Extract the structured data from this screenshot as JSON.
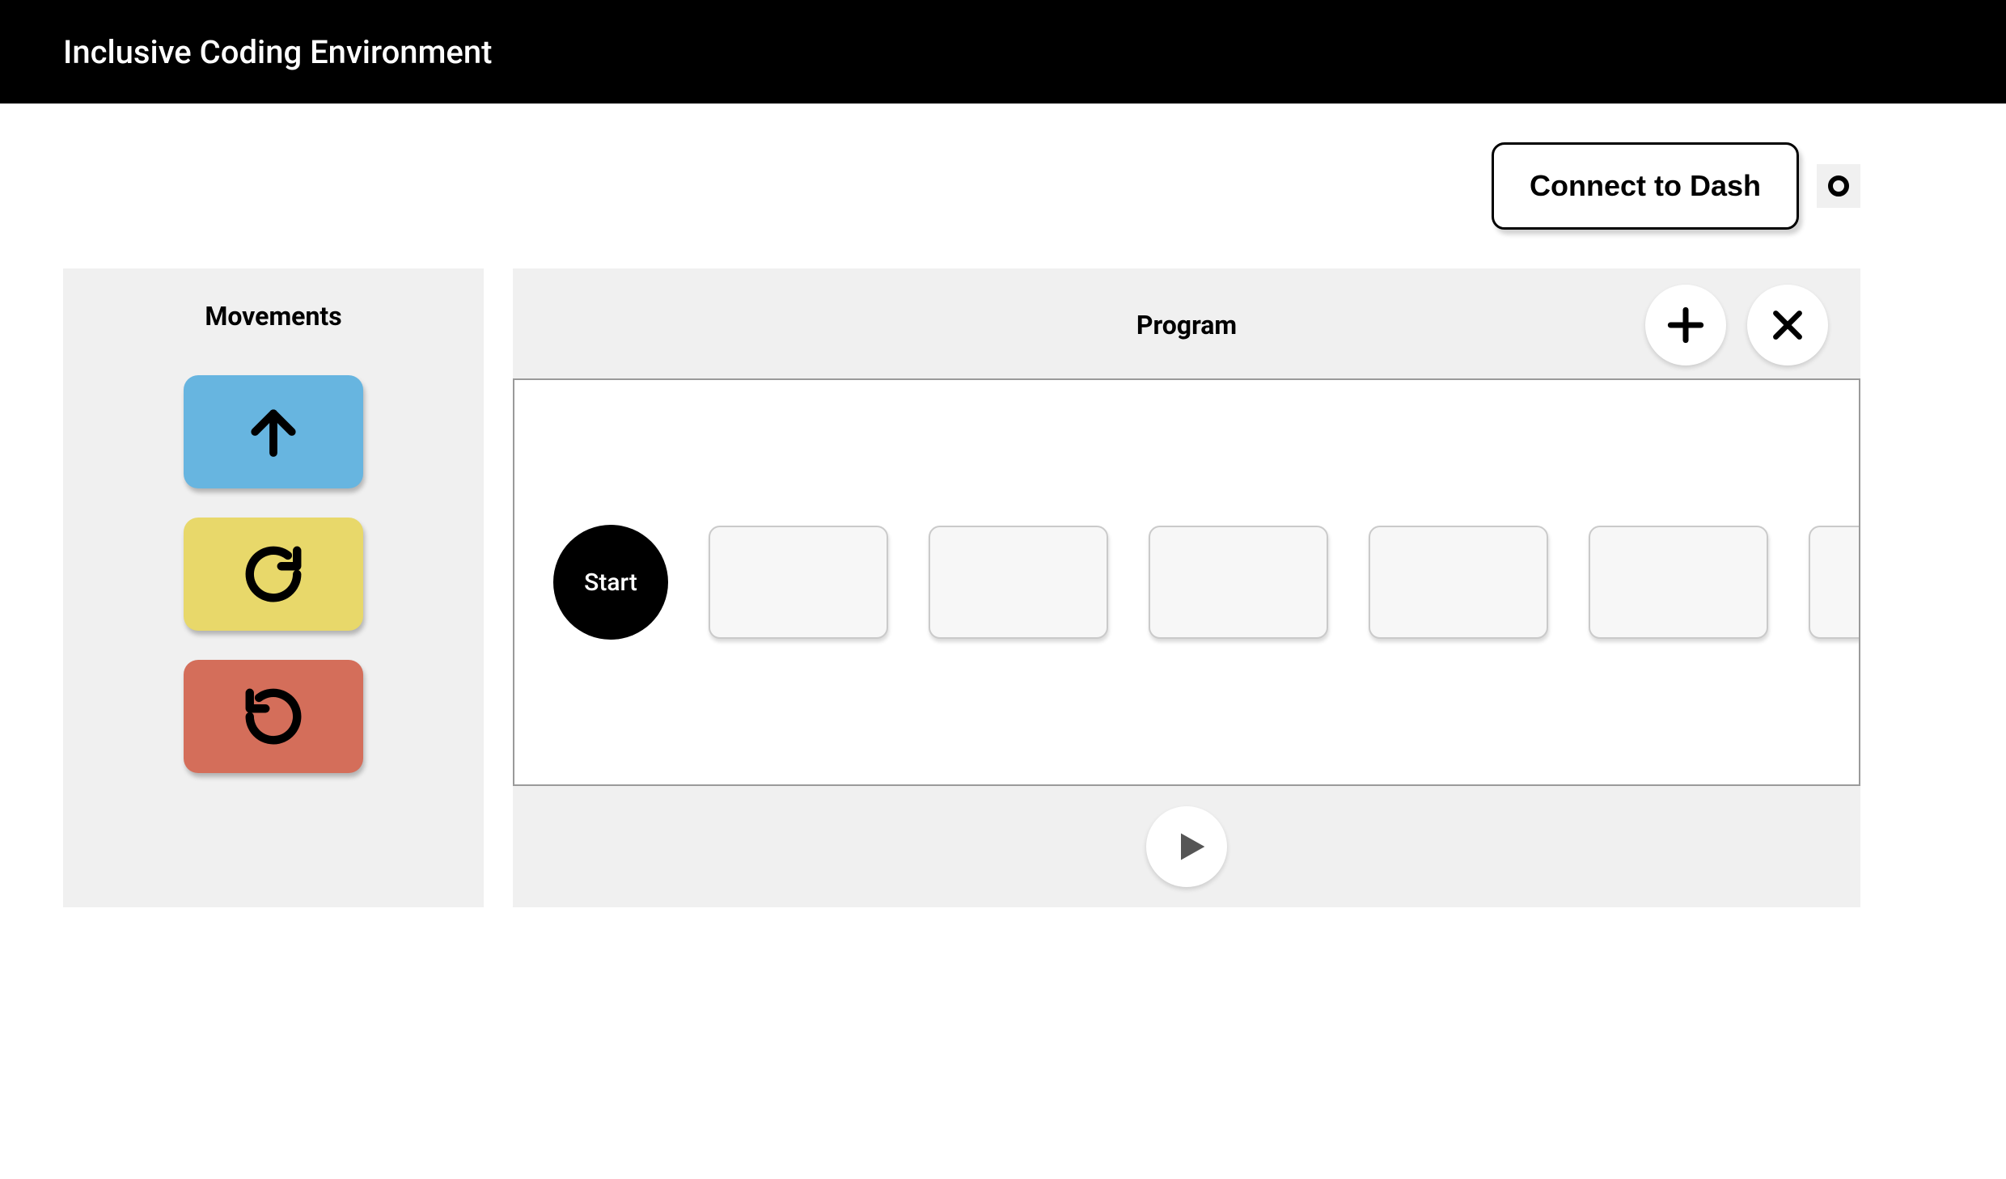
{
  "header": {
    "title": "Inclusive Coding Environment"
  },
  "connect": {
    "button_label": "Connect to Dash",
    "status_icon": "disconnected"
  },
  "sidebar": {
    "title": "Movements",
    "blocks": [
      {
        "name": "forward",
        "icon": "arrow-up-icon",
        "color": "#67b5e0"
      },
      {
        "name": "turn-right",
        "icon": "rotate-cw-icon",
        "color": "#e8d86a"
      },
      {
        "name": "turn-left",
        "icon": "rotate-ccw-icon",
        "color": "#d46e5a"
      }
    ]
  },
  "program": {
    "title": "Program",
    "add_icon": "plus-icon",
    "clear_icon": "x-icon",
    "start_label": "Start",
    "slot_count": 6,
    "play_icon": "play-icon"
  }
}
